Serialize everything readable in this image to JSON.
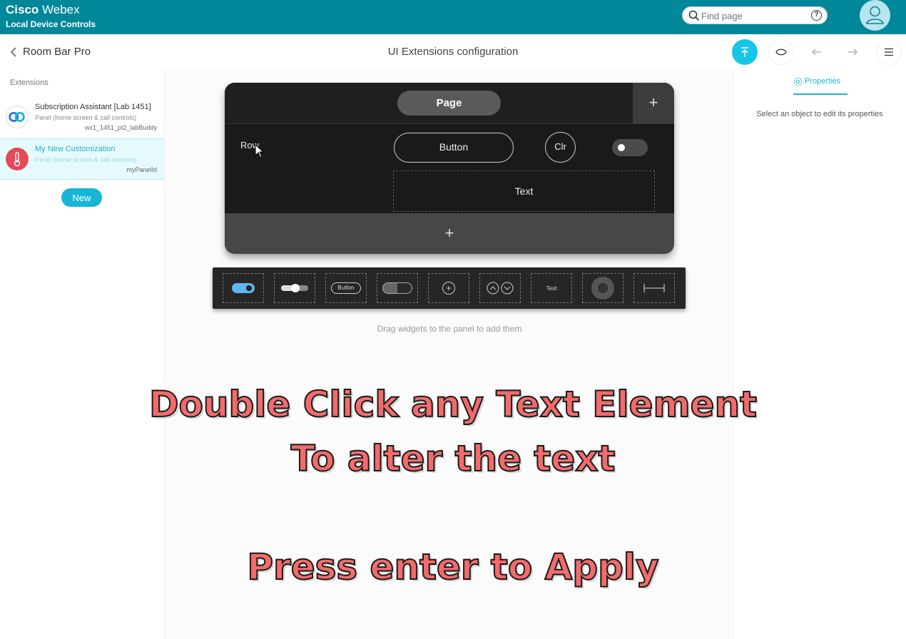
{
  "brand": {
    "line1_bold": "Cisco",
    "line1_rest": " Webex",
    "line2": "Local Device Controls"
  },
  "search": {
    "placeholder": "Find page",
    "help_icon": "question-icon"
  },
  "header": {
    "back_label": "Room Bar Pro",
    "title": "UI Extensions configuration",
    "buttons": [
      "upload-icon",
      "eye-icon",
      "undo-icon",
      "redo-icon",
      "menu-icon"
    ]
  },
  "sidebar": {
    "title": "Extensions",
    "items": [
      {
        "name": "Subscription Assistant [Lab 1451]",
        "sub": "Panel (home screen & call controls)",
        "id": "wx1_1451_pt2_labBuddy",
        "selected": false
      },
      {
        "name": "My New Customization",
        "sub": "Panel (home screen & call controls)",
        "id": "myPanelId",
        "selected": true
      }
    ],
    "new_label": "New"
  },
  "editor": {
    "page_tab": "Page",
    "row_label": "Row",
    "button_label": "Button",
    "circle_label": "Clr",
    "text_label": "Text",
    "tray_button_label": "Button",
    "tray_text_label": "Text",
    "hint": "Drag widgets to the panel to add them"
  },
  "captions": {
    "line1": "Double Click any Text Element",
    "line2": "To alter the text",
    "line3": "Press enter to Apply"
  },
  "properties": {
    "tab_label": "Properties",
    "message": "Select an object to edit its properties"
  },
  "colors": {
    "topbar": "#00879a",
    "accent": "#17c6e6",
    "caption": "#f26b6b"
  }
}
